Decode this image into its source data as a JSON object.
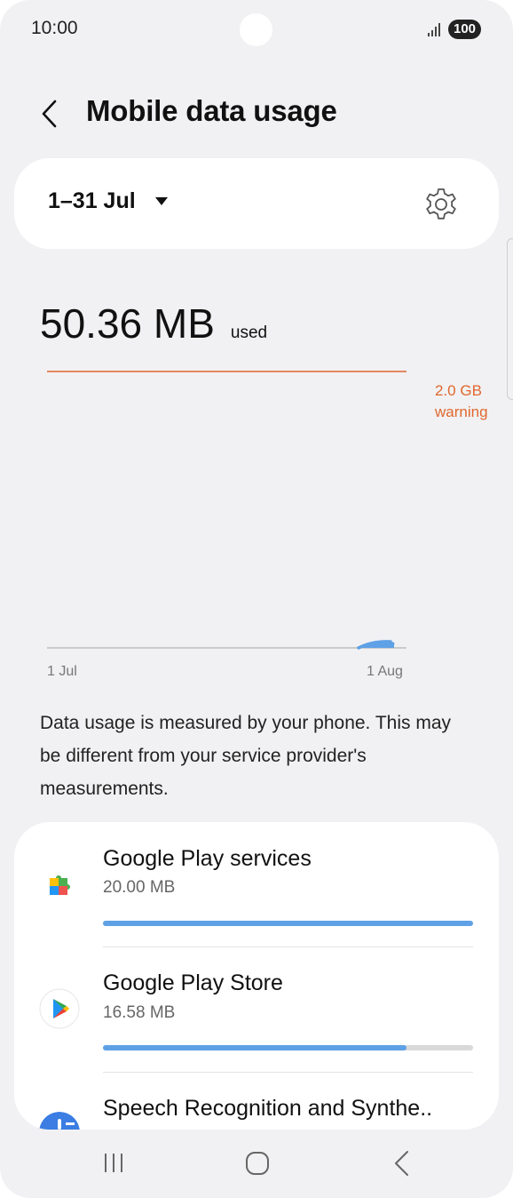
{
  "status_bar": {
    "time": "10:00",
    "battery": "100",
    "icons": [
      "signal-icon",
      "battery-icon"
    ]
  },
  "header": {
    "title": "Mobile data usage",
    "back_icon": "chevron-left-icon"
  },
  "period": {
    "label": "1–31 Jul",
    "dropdown_icon": "caret-down-icon",
    "settings_icon": "gear-icon"
  },
  "usage": {
    "value": "50.36 MB",
    "suffix": "used"
  },
  "chart": {
    "warning_line1": "2.0 GB",
    "warning_line2": "warning",
    "axis_start": "1 Jul",
    "axis_end": "1 Aug",
    "warning_color": "#e0672e",
    "usage_color": "#5ea1e6"
  },
  "info": {
    "text": "Data usage is measured by your phone. This may be different from your service provider's measurements."
  },
  "apps": [
    {
      "name": "Google Play services",
      "size": "20.00 MB",
      "fraction": 1.0,
      "icon": "google-play-services-icon"
    },
    {
      "name": "Google Play Store",
      "size": "16.58 MB",
      "fraction": 0.82,
      "icon": "google-play-store-icon"
    },
    {
      "name": "Speech Recognition and Synthe..",
      "size": "",
      "fraction": 0,
      "icon": "speech-recognition-icon"
    }
  ],
  "nav": {
    "recents_icon": "recents-icon",
    "home_icon": "home-icon",
    "back_icon": "back-icon"
  },
  "colors": {
    "background": "#f1f1f3",
    "card": "#ffffff",
    "accent": "#5ea1e6"
  }
}
